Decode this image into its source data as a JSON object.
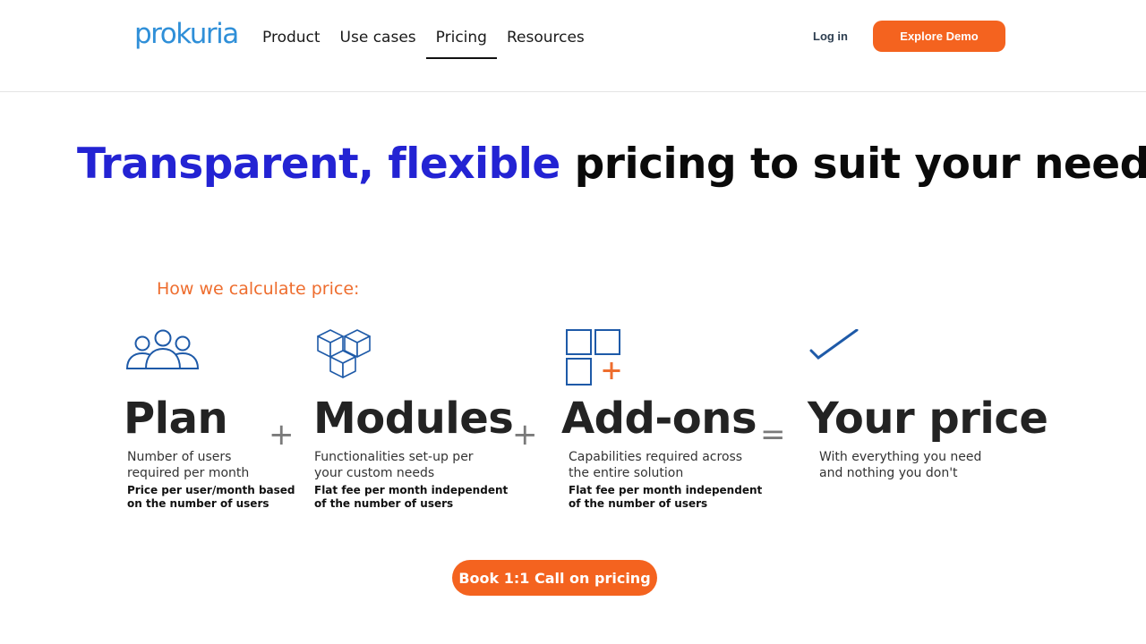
{
  "brand": {
    "logo_text": "prokuria",
    "accent_color": "#2f8fd8"
  },
  "nav": {
    "items": [
      {
        "label": "Product"
      },
      {
        "label": "Use cases"
      },
      {
        "label": "Pricing",
        "active": true
      },
      {
        "label": "Resources"
      }
    ],
    "login_label": "Log in",
    "demo_label": "Explore Demo"
  },
  "hero": {
    "title_accent": "Transparent, flexible",
    "title_rest": "pricing to suit your needs",
    "calc_label": "How we calculate price:"
  },
  "formula": {
    "plan": {
      "icon": "users-group-icon",
      "title": "Plan",
      "desc_line1": "Number of users",
      "desc_line2": "required per month",
      "note_line1": "Price per user/month based",
      "note_line2": "on the number of users"
    },
    "plus1": "+",
    "modules": {
      "icon": "cubes-icon",
      "title": "Modules",
      "desc_line1": "Functionalities set-up per",
      "desc_line2": "your custom needs",
      "note_line1": "Flat fee per month independent",
      "note_line2": "of the number of users"
    },
    "plus2": "+",
    "addons": {
      "icon": "add-blocks-icon",
      "title": "Add-ons",
      "desc_line1": "Capabilities required across",
      "desc_line2": "the entire solution",
      "note_line1": "Flat fee per month independent",
      "note_line2": "of the number of users"
    },
    "equals": "=",
    "price": {
      "icon": "checkmark-icon",
      "title": "Your price",
      "desc_line1": "With everything you need",
      "desc_line2": "and nothing you don't"
    }
  },
  "cta": {
    "label": "Book 1:1 Call on pricing"
  },
  "colors": {
    "orange": "#f4631f",
    "title_blue": "#2323d3",
    "icon_blue": "#1e5aa8",
    "calc_orange": "#ee6d2e"
  }
}
